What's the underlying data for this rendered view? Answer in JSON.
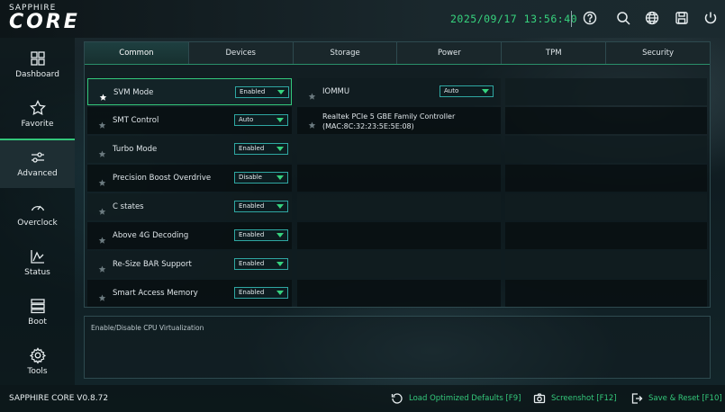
{
  "brand": {
    "top": "SAPPHIRE",
    "main": "CORE"
  },
  "datetime": "2025/09/17 13:56:40",
  "toolbar_icons": [
    "help-icon",
    "search-icon",
    "globe-icon",
    "save-icon",
    "power-icon"
  ],
  "sidebar": {
    "items": [
      {
        "label": "Dashboard",
        "icon": "dashboard-icon"
      },
      {
        "label": "Favorite",
        "icon": "star-icon"
      },
      {
        "label": "Advanced",
        "icon": "sliders-icon",
        "active": true
      },
      {
        "label": "Overclock",
        "icon": "gauge-icon"
      },
      {
        "label": "Status",
        "icon": "chart-icon"
      },
      {
        "label": "Boot",
        "icon": "server-icon"
      },
      {
        "label": "Tools",
        "icon": "gear-icon"
      }
    ]
  },
  "tabs": [
    "Common",
    "Devices",
    "Storage",
    "Power",
    "TPM",
    "Security"
  ],
  "active_tab": "Common",
  "settings_left": [
    {
      "label": "SVM Mode",
      "value": "Enabled",
      "favorite": true,
      "selected": true
    },
    {
      "label": "SMT Control",
      "value": "Auto"
    },
    {
      "label": "Turbo Mode",
      "value": "Enabled"
    },
    {
      "label": "Precision Boost Overdrive",
      "value": "Disable"
    },
    {
      "label": "C states",
      "value": "Enabled"
    },
    {
      "label": "Above 4G Decoding",
      "value": "Enabled"
    },
    {
      "label": "Re-Size BAR Support",
      "value": "Enabled"
    },
    {
      "label": "Smart Access Memory",
      "value": "Enabled"
    }
  ],
  "settings_mid": [
    {
      "label": "IOMMU",
      "value": "Auto"
    },
    {
      "label": "Realtek PCIe 5 GBE Family Controller",
      "label2": "(MAC:8C:32:23:5E:5E:08)"
    }
  ],
  "description": "Enable/Disable CPU Virtualization",
  "footer": {
    "version": "SAPPHIRE CORE V0.8.72",
    "load_defaults": "Load Optimized Defaults [F9]",
    "screenshot": "Screenshot [F12]",
    "save_reset": "Save & Reset [F10]"
  },
  "colors": {
    "accent": "#34c97b",
    "border": "#2fa7a2"
  }
}
